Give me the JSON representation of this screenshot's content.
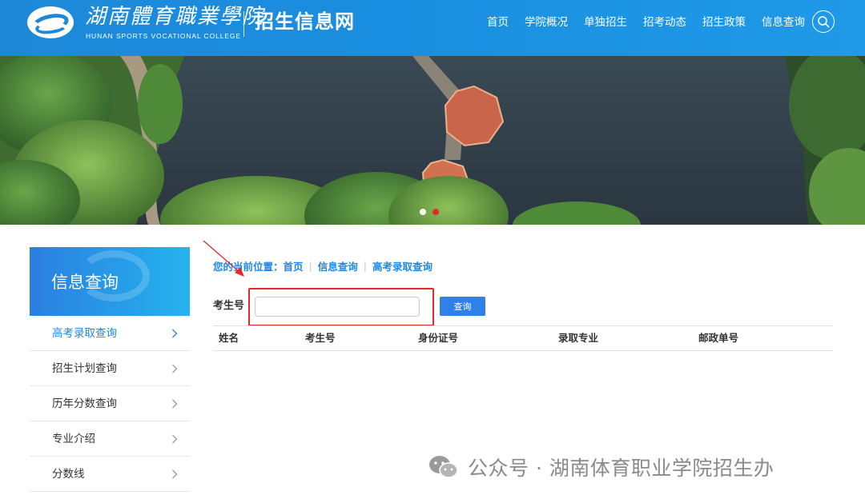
{
  "header": {
    "logo_cn": "湖南體育職業學院",
    "logo_en": "HUNAN SPORTS VOCATIONAL COLLEGE",
    "site_title": "招生信息网",
    "nav": [
      "首页",
      "学院概况",
      "单独招生",
      "招考动态",
      "招生政策",
      "信息查询"
    ],
    "search_icon": "search-icon"
  },
  "banner": {
    "slides": 2,
    "active_slide": 1
  },
  "sidebar": {
    "title": "信息查询",
    "items": [
      {
        "label": "高考录取查询",
        "active": true
      },
      {
        "label": "招生计划查询",
        "active": false
      },
      {
        "label": "历年分数查询",
        "active": false
      },
      {
        "label": "专业介绍",
        "active": false
      },
      {
        "label": "分数线",
        "active": false
      }
    ]
  },
  "breadcrumb": {
    "prefix": "您的当前位置：",
    "items": [
      "首页",
      "信息查询",
      "高考录取查询"
    ]
  },
  "query": {
    "label": "考生号",
    "input_value": "",
    "input_placeholder": "",
    "button_label": "查询"
  },
  "table": {
    "headers": [
      "姓名",
      "考生号",
      "身份证号",
      "录取专业",
      "邮政单号"
    ],
    "rows": []
  },
  "watermark": {
    "text": "公众号 · 湖南体育职业学院招生办"
  },
  "colors": {
    "header_blue": "#1e88d8",
    "accent_blue": "#1e88e5",
    "button_blue": "#2f80e7",
    "highlight_red": "#e8262b"
  }
}
